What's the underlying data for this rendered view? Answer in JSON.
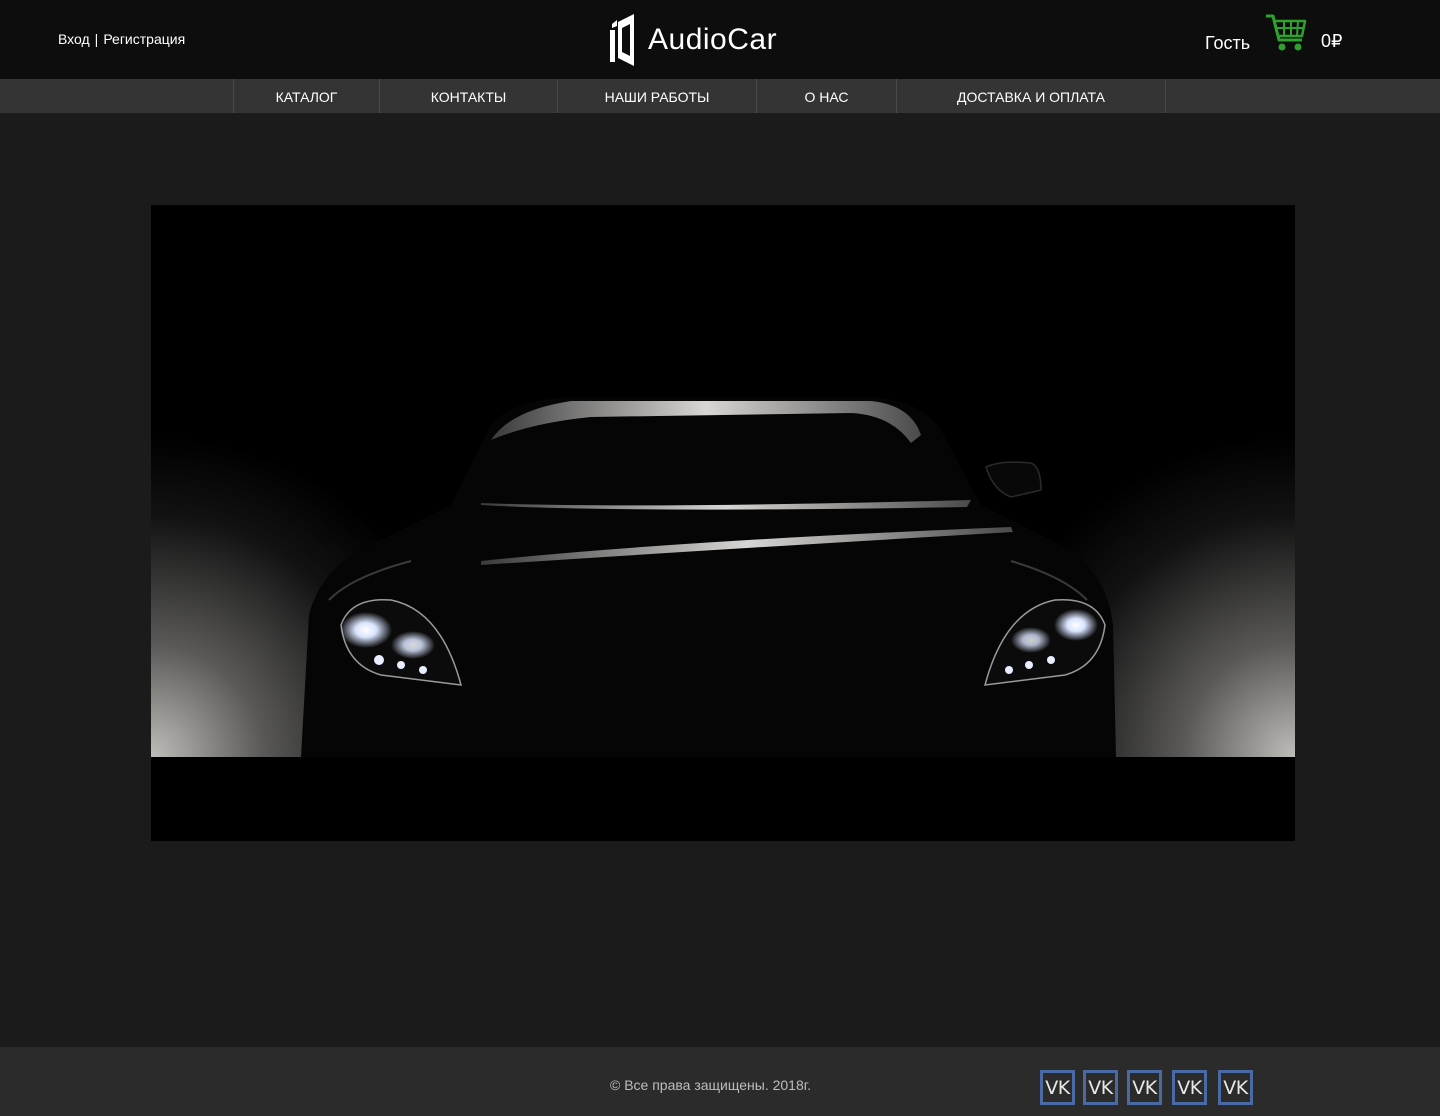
{
  "header": {
    "login_label": "Вход",
    "separator": "|",
    "register_label": "Регистрация",
    "logo_text": "AudioCar",
    "user_name": "Гость",
    "cart_total": "0₽",
    "cart_icon": "shopping-cart-icon",
    "cart_color": "#2fa12f"
  },
  "nav": {
    "items": [
      {
        "label": "КАТАЛОГ"
      },
      {
        "label": "КОНТАКТЫ"
      },
      {
        "label": "НАШИ РАБОТЫ"
      },
      {
        "label": "О НАС"
      },
      {
        "label": "ДОСТАВКА И ОПЛАТА"
      }
    ]
  },
  "hero": {
    "image": "dark-car-front-with-headlights"
  },
  "footer": {
    "copyright": "© Все права защищены. 2018г.",
    "socials": [
      {
        "label": "VK",
        "icon": "vk-icon"
      },
      {
        "label": "VK",
        "icon": "vk-icon"
      },
      {
        "label": "VK",
        "icon": "vk-icon"
      },
      {
        "label": "VK",
        "icon": "vk-icon"
      },
      {
        "label": "VK",
        "icon": "vk-icon"
      }
    ],
    "social_border_color": "#4a6aa6"
  }
}
